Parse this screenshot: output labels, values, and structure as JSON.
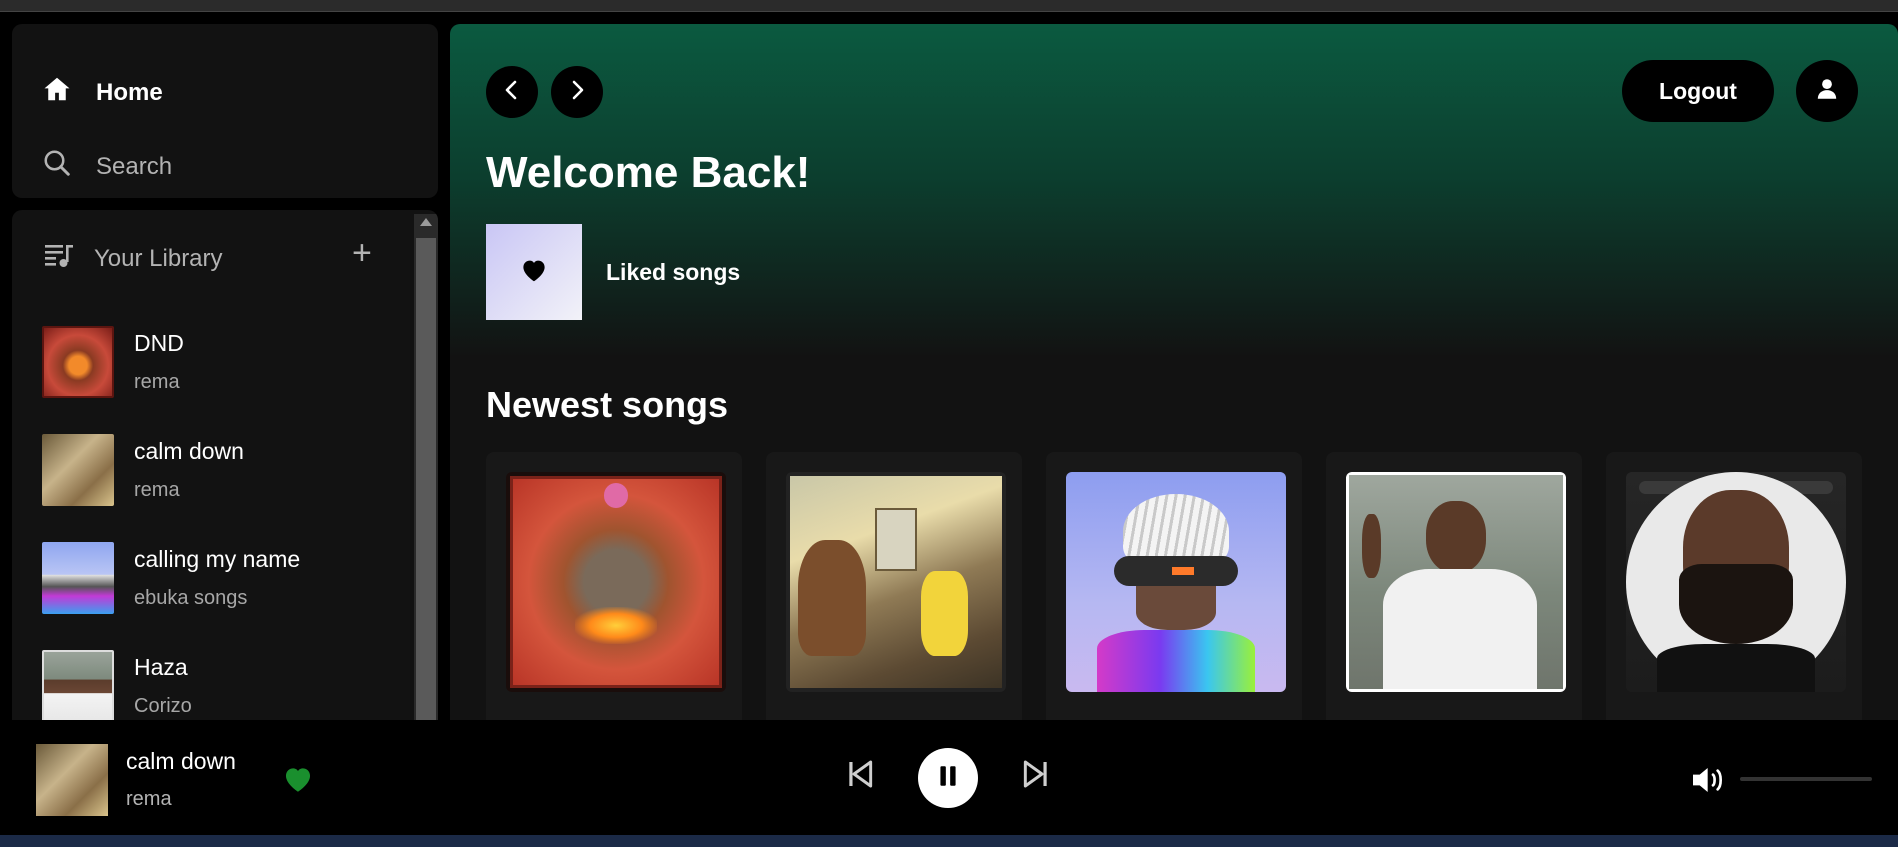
{
  "nav": {
    "home_label": "Home",
    "search_label": "Search"
  },
  "library": {
    "title": "Your Library",
    "add_label": "+",
    "items": [
      {
        "title": "DND",
        "artist": "rema",
        "art": "art-dnd"
      },
      {
        "title": "calm down",
        "artist": "rema",
        "art": "art-calmdown"
      },
      {
        "title": "calling my name",
        "artist": "ebuka songs",
        "art": "art-calling"
      },
      {
        "title": "Haza",
        "artist": "Corizo",
        "art": "art-haza"
      }
    ]
  },
  "header": {
    "logout_label": "Logout"
  },
  "main": {
    "welcome": "Welcome Back!",
    "liked_songs_label": "Liked songs",
    "newest_title": "Newest songs"
  },
  "player": {
    "title": "calm down",
    "artist": "rema",
    "liked": true
  },
  "colors": {
    "accent_green": "#1db954",
    "heart_green": "#1a8f2e",
    "gradient_top": "#0b5a40",
    "surface": "#121212"
  }
}
